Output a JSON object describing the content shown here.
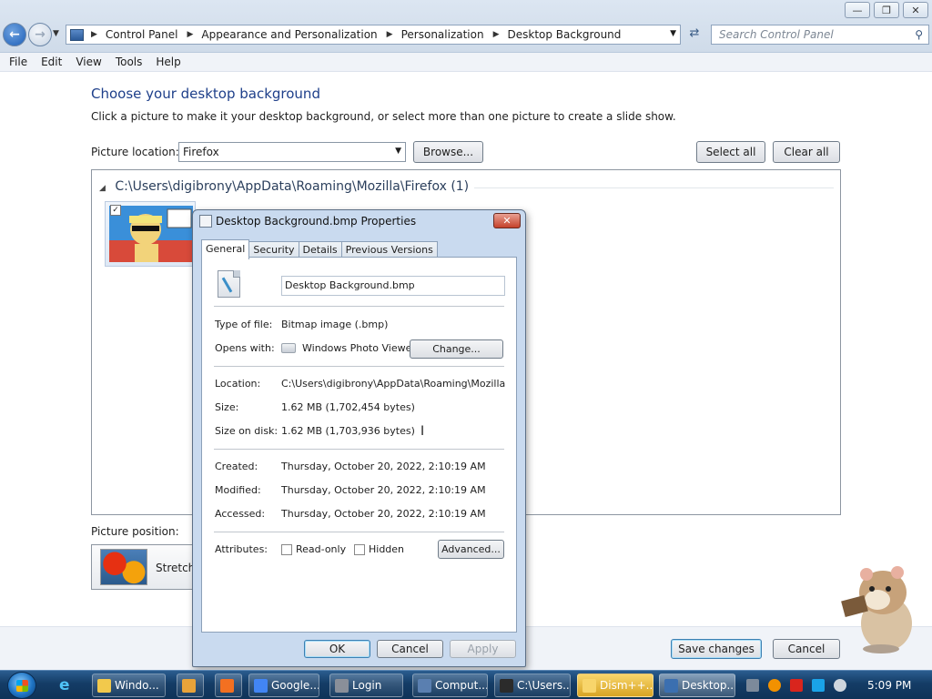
{
  "window": {
    "buttons": {
      "minimize": "—",
      "restore": "❐",
      "close": "✕"
    }
  },
  "address": {
    "crumbs": [
      "Control Panel",
      "Appearance and Personalization",
      "Personalization",
      "Desktop Background"
    ],
    "search_placeholder": "Search Control Panel"
  },
  "menu": [
    "File",
    "Edit",
    "View",
    "Tools",
    "Help"
  ],
  "main": {
    "title": "Choose your desktop background",
    "description": "Click a picture to make it your desktop background, or select more than one picture to create a slide show.",
    "picture_location_label": "Picture location:",
    "picture_location_value": "Firefox",
    "browse_label": "Browse...",
    "select_all_label": "Select all",
    "clear_all_label": "Clear all",
    "folder_path": "C:\\Users\\digibrony\\AppData\\Roaming\\Mozilla\\Firefox (1)",
    "picture_position_label": "Picture position:",
    "picture_position_value": "Stretch",
    "save_label": "Save changes",
    "cancel_label": "Cancel"
  },
  "dialog": {
    "title": "Desktop Background.bmp Properties",
    "close_glyph": "✕",
    "tabs": [
      "General",
      "Security",
      "Details",
      "Previous Versions"
    ],
    "active_tab": "General",
    "filename": "Desktop Background.bmp",
    "type_label": "Type of file:",
    "type_value": "Bitmap image (.bmp)",
    "opens_label": "Opens with:",
    "opens_value": "Windows Photo Viewer",
    "change_label": "Change...",
    "location_label": "Location:",
    "location_value": "C:\\Users\\digibrony\\AppData\\Roaming\\Mozilla\\Firefox",
    "size_label": "Size:",
    "size_value": "1.62 MB (1,702,454 bytes)",
    "size_disk_label": "Size on disk:",
    "size_disk_value": "1.62 MB (1,703,936 bytes)",
    "created_label": "Created:",
    "created_value": "Thursday, October 20, 2022, 2:10:19 AM",
    "modified_label": "Modified:",
    "modified_value": "Thursday, October 20, 2022, 2:10:19 AM",
    "accessed_label": "Accessed:",
    "accessed_value": "Thursday, October 20, 2022, 2:10:19 AM",
    "attributes_label": "Attributes:",
    "readonly_label": "Read-only",
    "hidden_label": "Hidden",
    "advanced_label": "Advanced...",
    "ok_label": "OK",
    "cancel_label": "Cancel",
    "apply_label": "Apply"
  },
  "taskbar": {
    "items": [
      {
        "label": "Windo...",
        "icon_color": "#f2c94c"
      },
      {
        "label": "",
        "icon_color": "#e8a33a"
      },
      {
        "label": "",
        "icon_color": "#f37021"
      },
      {
        "label": "Google...",
        "icon_color": "#4285f4"
      },
      {
        "label": "Login",
        "icon_color": "#8a8f99"
      },
      {
        "label": "Comput...",
        "icon_color": "#5a7fb0"
      },
      {
        "label": "C:\\Users...",
        "icon_color": "#2b2b2b"
      },
      {
        "label": "Dism++...",
        "icon_color": "#f8d56b"
      },
      {
        "label": "Desktop...",
        "icon_color": "#3b6fb0"
      }
    ],
    "clock": "5:09 PM"
  }
}
